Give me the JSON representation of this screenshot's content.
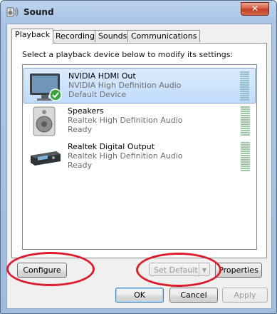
{
  "window": {
    "title": "Sound",
    "close_label": "✕"
  },
  "tabs": [
    {
      "label": "Playback",
      "active": true
    },
    {
      "label": "Recording",
      "active": false
    },
    {
      "label": "Sounds",
      "active": false
    },
    {
      "label": "Communications",
      "active": false
    }
  ],
  "instruction": "Select a playback device below to modify its settings:",
  "devices": [
    {
      "name": "NVIDIA HDMI Out",
      "driver": "NVIDIA High Definition Audio",
      "status": "Default Device",
      "icon": "monitor-icon",
      "selected": true,
      "default": true
    },
    {
      "name": "Speakers",
      "driver": "Realtek High Definition Audio",
      "status": "Ready",
      "icon": "speaker-icon",
      "selected": false
    },
    {
      "name": "Realtek Digital Output",
      "driver": "Realtek High Definition Audio",
      "status": "Ready",
      "icon": "digital-output-icon",
      "selected": false
    }
  ],
  "buttons": {
    "configure": "Configure",
    "set_default": "Set Default",
    "properties": "Properties",
    "ok": "OK",
    "cancel": "Cancel",
    "apply": "Apply"
  },
  "colors": {
    "annotation": "#dd1d2b",
    "selection": "#c1dcfc",
    "default_check": "#3aa53a"
  }
}
